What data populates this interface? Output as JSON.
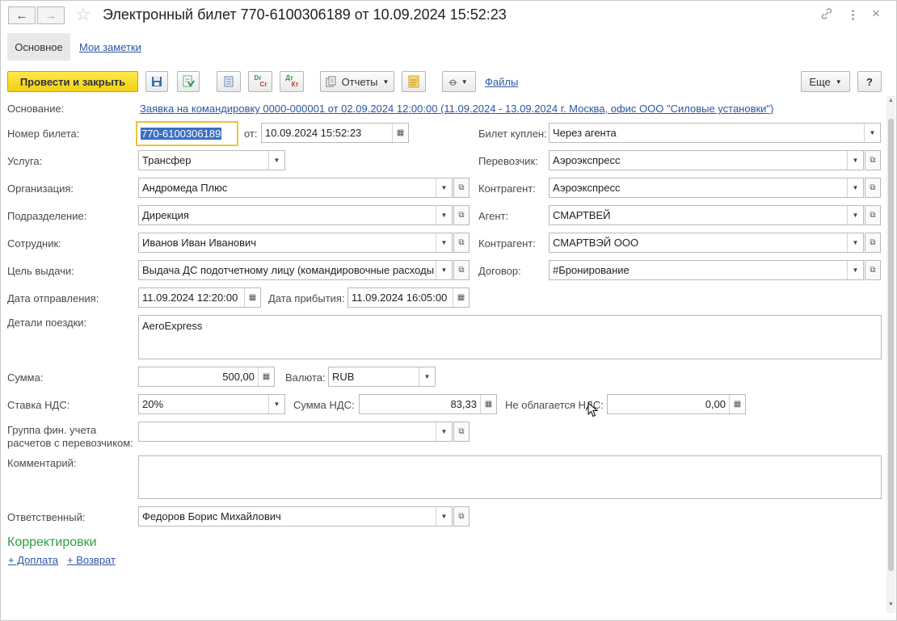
{
  "window": {
    "title": "Электронный билет 770-6100306189 от 10.09.2024 15:52:23",
    "back_icon": "←",
    "forward_icon": "→",
    "star_icon": "☆",
    "link_icon": "🔗",
    "more_icon": "⋮",
    "close_icon": "×"
  },
  "tabs": {
    "main": "Основное",
    "notes": "Мои заметки"
  },
  "toolbar": {
    "post_close": "Провести и закрыть",
    "reports": "Отчеты",
    "files": "Файлы",
    "more": "Еще",
    "help": "?",
    "dr_top": "Dr",
    "dr_bottom": "Cr",
    "dt_top": "Дт",
    "dt_bottom": "Кт"
  },
  "form": {
    "basis_label": "Основание:",
    "basis_link": "Заявка на командировку 0000-000001 от 02.09.2024 12:00:00 (11.09.2024 - 13.09.2024 г. Москва, офис ООО \"Силовые установки\")",
    "ticket_no_label": "Номер билета:",
    "ticket_no": "770-6100306189",
    "from_label": "от:",
    "from_date": "10.09.2024 15:52:23",
    "bought_label": "Билет куплен:",
    "bought": "Через агента",
    "service_label": "Услуга:",
    "service": "Трансфер",
    "carrier_label": "Перевозчик:",
    "carrier": "Аэроэкспресс",
    "org_label": "Организация:",
    "org": "Андромеда Плюс",
    "contractor1_label": "Контрагент:",
    "contractor1": "Аэроэкспресс",
    "dept_label": "Подразделение:",
    "dept": "Дирекция",
    "agent_label": "Агент:",
    "agent": "СМАРТВЕЙ",
    "employee_label": "Сотрудник:",
    "employee": "Иванов Иван Иванович",
    "contractor2_label": "Контрагент:",
    "contractor2": "СМАРТВЭЙ ООО",
    "purpose_label": "Цель выдачи:",
    "purpose": "Выдача ДС подотчетному лицу (командировочные расходы",
    "contract_label": "Договор:",
    "contract": "#Бронирование",
    "depart_label": "Дата отправления:",
    "depart": "11.09.2024 12:20:00",
    "arrive_label": "Дата прибытия:",
    "arrive": "11.09.2024 16:05:00",
    "details_label": "Детали поездки:",
    "details": "AeroExpress",
    "sum_label": "Сумма:",
    "sum": "500,00",
    "currency_label": "Валюта:",
    "currency": "RUB",
    "vat_rate_label": "Ставка НДС:",
    "vat_rate": "20%",
    "vat_sum_label": "Сумма НДС:",
    "vat_sum": "83,33",
    "novat_label": "Не облагается НДС:",
    "novat": "0,00",
    "group_label_1": "Группа фин. учета",
    "group_label_2": "расчетов с перевозчиком:",
    "group": "",
    "comment_label": "Комментарий:",
    "comment": "",
    "responsible_label": "Ответственный:",
    "responsible": "Федоров Борис Михайлович"
  },
  "corrections": {
    "title": "Корректировки",
    "surcharge": "+ Доплата",
    "refund": "+ Возврат"
  }
}
